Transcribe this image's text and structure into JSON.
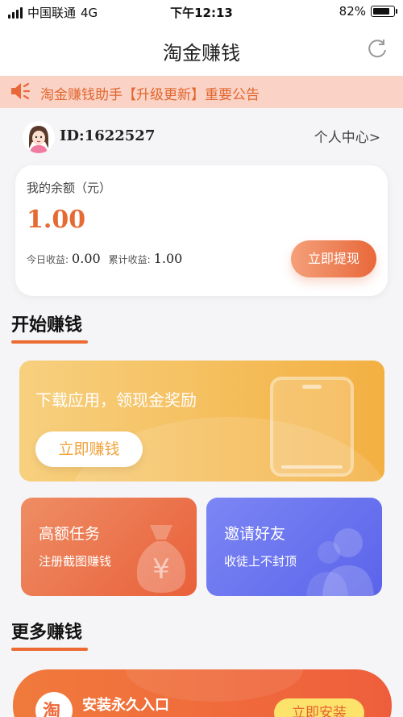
{
  "status_bar": {
    "carrier": "中国联通",
    "network": "4G",
    "time": "下午12:13",
    "battery": "82%"
  },
  "nav": {
    "title": "淘金赚钱"
  },
  "notice": {
    "text": "淘金赚钱助手【升级更新】重要公告"
  },
  "user": {
    "id": "ID:1622527",
    "center_link": "个人中心>"
  },
  "balance": {
    "label": "我的余额（元）",
    "amount": "1.00",
    "today_label": "今日收益:",
    "today_value": "0.00",
    "total_label": "累计收益:",
    "total_value": "1.00",
    "withdraw_label": "立即提现"
  },
  "start_section": {
    "title": "开始赚钱"
  },
  "earn_banner": {
    "title": "下载应用，领现金奖励",
    "button": "立即赚钱"
  },
  "cards": [
    {
      "title": "高额任务",
      "subtitle": "注册截图赚钱",
      "icon": "moneybag-icon"
    },
    {
      "title": "邀请好友",
      "subtitle": "收徒上不封顶",
      "icon": "users-icon"
    }
  ],
  "more_section": {
    "title": "更多赚钱"
  },
  "install_card": {
    "icon_char": "淘",
    "title": "安装永久入口",
    "button": "立即安装"
  },
  "colors": {
    "accent": "#e56b32",
    "notice_bg": "#fbd3c6",
    "banner_gold": "#f3b042",
    "card_blue": "#5b64ea"
  }
}
